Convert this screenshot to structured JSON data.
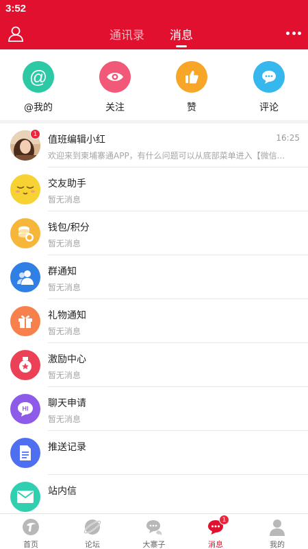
{
  "status_bar": {
    "time": "3:52"
  },
  "header": {
    "tabs": [
      {
        "label": "通讯录",
        "active": false
      },
      {
        "label": "消息",
        "active": true
      }
    ],
    "user_icon": "user-outline-icon",
    "more_icon": "more-dots-icon"
  },
  "quick_actions": [
    {
      "label": "@我的",
      "icon": "at-icon",
      "color": "#2dc9a5"
    },
    {
      "label": "关注",
      "icon": "eye-icon",
      "color": "#f25877"
    },
    {
      "label": "赞",
      "icon": "thumbs-up-icon",
      "color": "#f7a628"
    },
    {
      "label": "评论",
      "icon": "comment-icon",
      "color": "#36b7ee"
    }
  ],
  "messages": [
    {
      "title": "值班编辑小红",
      "preview": "欢迎来到柬埔寨通APP，有什么问题可以从底部菜单进入【微信...",
      "time": "16:25",
      "badge": "1",
      "icon": "user-photo-avatar"
    },
    {
      "title": "交友助手",
      "preview": "暂无消息",
      "icon": "sleepy-face-icon",
      "color": "#f7d233"
    },
    {
      "title": "钱包/积分",
      "preview": "暂无消息",
      "icon": "coins-icon",
      "color": "#f5b63a"
    },
    {
      "title": "群通知",
      "preview": "暂无消息",
      "icon": "group-icon",
      "color": "#2f7fe4"
    },
    {
      "title": "礼物通知",
      "preview": "暂无消息",
      "icon": "gift-icon",
      "color": "#f6814d"
    },
    {
      "title": "激励中心",
      "preview": "暂无消息",
      "icon": "medal-icon",
      "color": "#eb4055"
    },
    {
      "title": "聊天申请",
      "preview": "暂无消息",
      "icon": "hi-chat-icon",
      "color": "#8d5be8"
    },
    {
      "title": "推送记录",
      "preview": "",
      "icon": "document-icon",
      "color": "#4e6ff0"
    },
    {
      "title": "站内信",
      "preview": "",
      "icon": "envelope-icon",
      "color": "#2fcfb0"
    }
  ],
  "tab_bar": [
    {
      "label": "首页",
      "icon": "home-logo-icon",
      "active": false
    },
    {
      "label": "论坛",
      "icon": "forum-planet-icon",
      "active": false
    },
    {
      "label": "大寨子",
      "icon": "chat-bubbles-icon",
      "active": false
    },
    {
      "label": "消息",
      "icon": "message-bubble-icon",
      "active": true,
      "badge": "1"
    },
    {
      "label": "我的",
      "icon": "profile-icon",
      "active": false
    }
  ],
  "colors": {
    "brand_red": "#e0102e",
    "muted_text": "#a5a5a5"
  }
}
